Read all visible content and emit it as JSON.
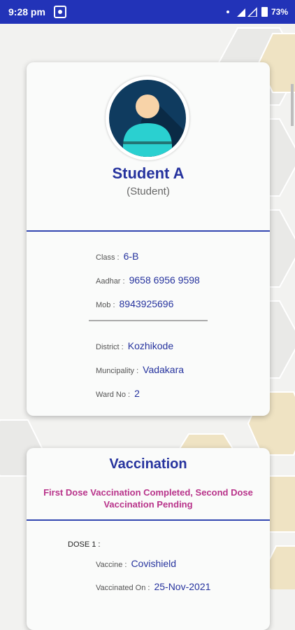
{
  "status_bar": {
    "time": "9:28 pm",
    "battery": "73%"
  },
  "profile": {
    "name": "Student A",
    "role": "(Student)",
    "fields": [
      {
        "label": "Class :",
        "value": "6-B"
      },
      {
        "label": "Aadhar :",
        "value": "9658 6956 9598"
      },
      {
        "label": "Mob :",
        "value": "8943925696"
      }
    ],
    "location": [
      {
        "label": "District :",
        "value": "Kozhikode"
      },
      {
        "label": "Muncipality :",
        "value": "Vadakara"
      },
      {
        "label": "Ward No :",
        "value": "2"
      }
    ]
  },
  "vaccination": {
    "title": "Vaccination",
    "status": "First Dose Vaccination Completed, Second Dose Vaccination Pending",
    "dose_label": "DOSE 1 :",
    "vaccine_label": "Vaccine :",
    "vaccine_value": "Covishield",
    "date_label": "Vaccinated On :",
    "date_value": "25-Nov-2021"
  },
  "colors": {
    "primary": "#26339e",
    "status_bar": "#2233b8",
    "status_text": "#b8338a",
    "avatar_bg": "#0f3b5f",
    "avatar_body": "#2ad0d0",
    "avatar_face": "#f8d3a8"
  },
  "icons": [
    "screen-record-icon",
    "signal-icon",
    "battery-icon",
    "user-avatar-icon"
  ]
}
